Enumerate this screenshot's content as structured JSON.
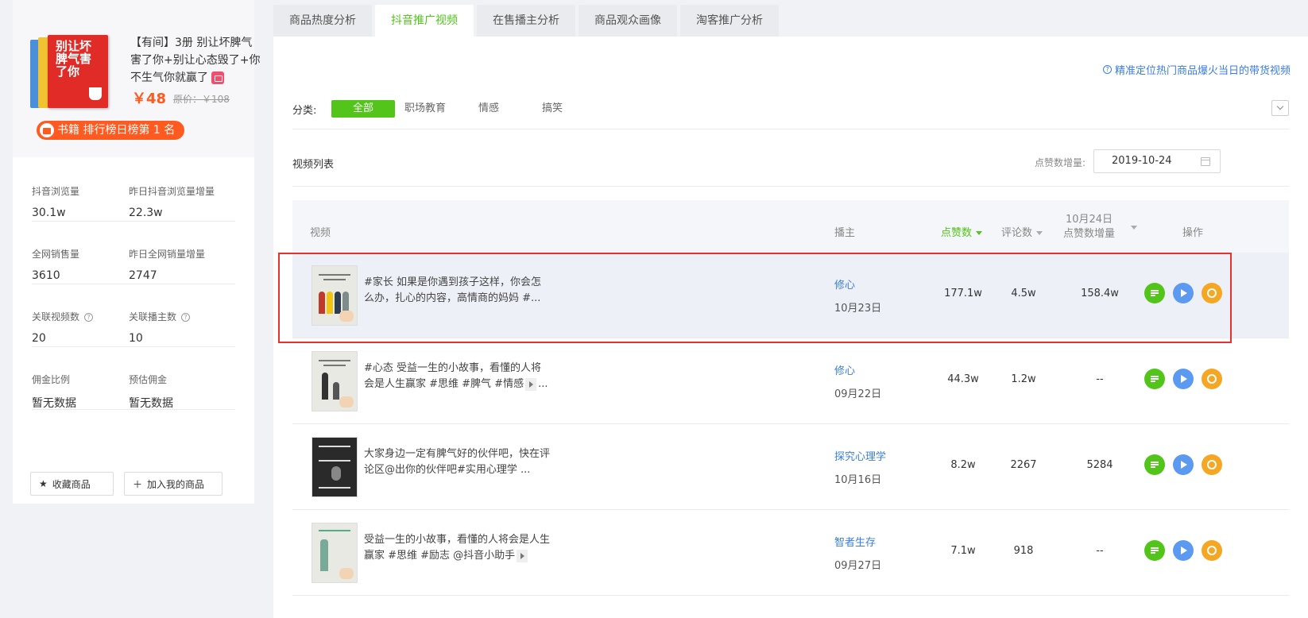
{
  "product": {
    "cover_text": "别让坏脾气害了你",
    "title": "【有间】3册 别让坏脾气害了你+别让心态毁了+你不生气你就赢了",
    "price": "￥48",
    "original_price": "原价：￥108",
    "rank_badge": "书籍 排行榜日榜第 1 名"
  },
  "stats": [
    {
      "label": "抖音浏览量",
      "value": "30.1w"
    },
    {
      "label": "昨日抖音浏览量增量",
      "value": "22.3w"
    },
    {
      "label": "全网销售量",
      "value": "3610"
    },
    {
      "label": "昨日全网销量增量",
      "value": "2747"
    },
    {
      "label": "关联视频数",
      "value": "20"
    },
    {
      "label": "关联播主数",
      "value": "10"
    },
    {
      "label": "佣金比例",
      "value": "暂无数据"
    },
    {
      "label": "预估佣金",
      "value": "暂无数据"
    }
  ],
  "actions": {
    "favorite": "收藏商品",
    "add_mine": "加入我的商品"
  },
  "tabs": [
    "商品热度分析",
    "抖音推广视频",
    "在售播主分析",
    "商品观众画像",
    "淘客推广分析"
  ],
  "active_tab": "抖音推广视频",
  "top_link": "精准定位热门商品爆火当日的带货视频",
  "category": {
    "label": "分类:",
    "items": [
      "全部",
      "职场教育",
      "情感",
      "搞笑"
    ]
  },
  "list": {
    "title": "视频列表",
    "date_label": "点赞数增量:",
    "date_value": "2019-10-24"
  },
  "table": {
    "headers": {
      "video": "视频",
      "author": "播主",
      "likes": "点赞数",
      "comments": "评论数",
      "incr_line1": "10月24日",
      "incr_line2": "点赞数增量",
      "ops": "操作"
    },
    "rows": [
      {
        "title": "#家长 如果是你遇到孩子这样，你会怎么办，扎心的内容，高情商的妈妈 #...",
        "author": "修心",
        "date": "10月23日",
        "likes": "177.1w",
        "comments": "4.5w",
        "incr": "158.4w"
      },
      {
        "title": "#心态 受益一生的小故事，看懂的人将会是人生赢家 #思维 #脾气 #情感",
        "title_tail": "...",
        "author": "修心",
        "date": "09月22日",
        "likes": "44.3w",
        "comments": "1.2w",
        "incr": "--"
      },
      {
        "title": "大家身边一定有脾气好的伙伴吧，快在评论区@出你的伙伴吧#实用心理学 ...",
        "author": "探究心理学",
        "date": "10月16日",
        "likes": "8.2w",
        "comments": "2267",
        "incr": "5284"
      },
      {
        "title": "受益一生的小故事，看懂的人将会是人生赢家 #思维 #励志 @抖音小助手",
        "title_tail": "",
        "author": "智者生存",
        "date": "09月27日",
        "likes": "7.1w",
        "comments": "918",
        "incr": "--"
      }
    ]
  },
  "colors": {
    "accent": "#52c41a",
    "link": "#3b7ddd",
    "price": "#ff5a1f",
    "highlight_border": "#e5322d"
  }
}
